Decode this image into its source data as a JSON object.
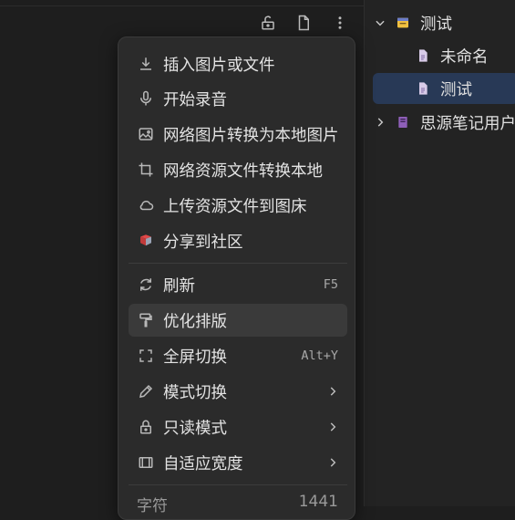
{
  "toolbar": {
    "lock_icon": "unlock-icon",
    "doc_icon": "document-icon",
    "more_icon": "more-vertical-icon"
  },
  "menu": {
    "items": [
      {
        "label": "插入图片或文件",
        "icon": "download-icon"
      },
      {
        "label": "开始录音",
        "icon": "microphone-icon"
      },
      {
        "label": "网络图片转换为本地图片",
        "icon": "image-icon"
      },
      {
        "label": "网络资源文件转换本地",
        "icon": "crop-icon"
      },
      {
        "label": "上传资源文件到图床",
        "icon": "cloud-icon"
      },
      {
        "label": "分享到社区",
        "icon": "community-icon"
      },
      {
        "label": "刷新",
        "icon": "refresh-icon",
        "shortcut": "F5"
      },
      {
        "label": "优化排版",
        "icon": "format-paint-icon"
      },
      {
        "label": "全屏切换",
        "icon": "fullscreen-icon",
        "shortcut": "Alt+Y"
      },
      {
        "label": "模式切换",
        "icon": "pencil-icon"
      },
      {
        "label": "只读模式",
        "icon": "lock-icon"
      },
      {
        "label": "自适应宽度",
        "icon": "panel-icon"
      }
    ],
    "footer": {
      "label": "字符",
      "value": "1441"
    }
  },
  "tree": {
    "notebook": {
      "label": "测试",
      "icon": "notebook-icon"
    },
    "docs": [
      {
        "label": "未命名"
      },
      {
        "label": "测试"
      }
    ],
    "second_notebook": {
      "label": "思源笔记用户"
    }
  },
  "colors": {
    "selection": "#283956",
    "menu_bg": "#2b2b2b",
    "active_item": "#3a3a3a",
    "community_icon": "#d94545"
  }
}
